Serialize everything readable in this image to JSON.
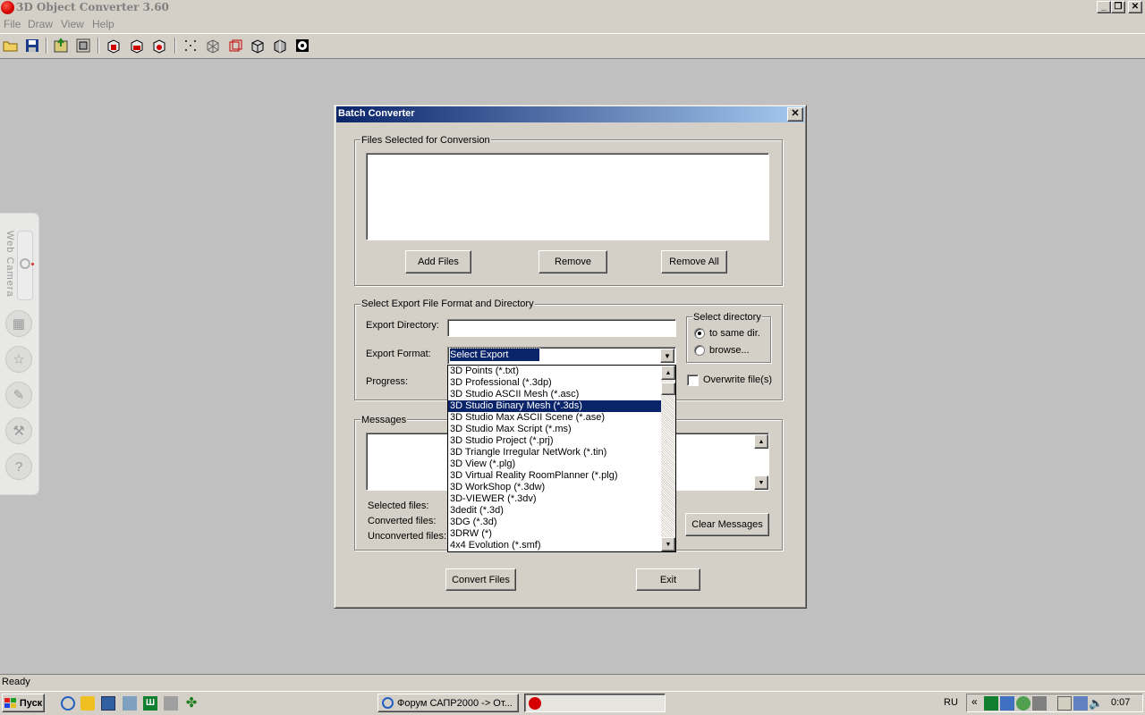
{
  "app": {
    "title": "3D Object Converter 3.60"
  },
  "menu": [
    "File",
    "Draw",
    "View",
    "Help"
  ],
  "side_panel": {
    "label": "Web Camera"
  },
  "dialog": {
    "title": "Batch Converter",
    "files_group": {
      "label": "Files Selected for Conversion",
      "add": "Add Files",
      "remove": "Remove",
      "remove_all": "Remove All"
    },
    "export_group": {
      "label": "Select Export File Format and Directory",
      "dir_label": "Export Directory:",
      "dir_value": "",
      "format_label": "Export Format:",
      "format_value": "Select Export Format",
      "progress_label": "Progress:",
      "select_dir_label": "Select directory",
      "opt_same": "to same dir.",
      "opt_browse": "browse...",
      "overwrite": "Overwrite file(s)"
    },
    "format_options": [
      "3D Points (*.txt)",
      "3D Professional (*.3dp)",
      "3D Studio ASCII Mesh (*.asc)",
      "3D Studio Binary Mesh (*.3ds)",
      "3D Studio Max ASCII Scene (*.ase)",
      "3D Studio Max Script (*.ms)",
      "3D Studio Project (*.prj)",
      "3D Triangle Irregular NetWork (*.tin)",
      "3D View (*.plg)",
      "3D Virtual Reality RoomPlanner (*.plg)",
      "3D WorkShop (*.3dw)",
      "3D-VIEWER (*.3dv)",
      "3dedit (*.3d)",
      "3DG (*.3d)",
      "3DRW (*)",
      "4x4 Evolution (*.smf)"
    ],
    "selected_option": "3D Studio Binary Mesh (*.3ds)",
    "messages_group": {
      "label": "Messages",
      "selected": "Selected files:",
      "converted": "Converted files:",
      "unconverted": "Unconverted files:",
      "clear": "Clear Messages"
    },
    "convert": "Convert Files",
    "exit": "Exit"
  },
  "status": "Ready",
  "taskbar": {
    "start": "Пуск",
    "task1": "Форум САПР2000 -> От...",
    "lang": "RU",
    "time": "0:07",
    "chevron": "«"
  }
}
